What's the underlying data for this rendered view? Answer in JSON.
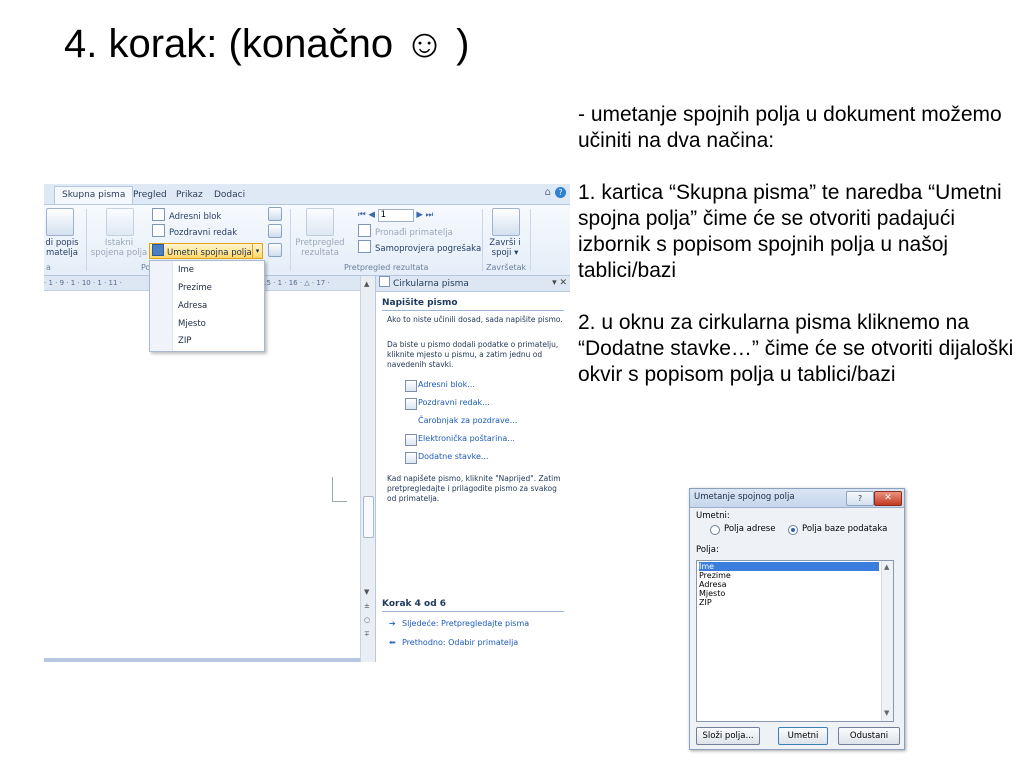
{
  "slide": {
    "title": "4. korak: (konačno ☺ )",
    "paragraphs": [
      "- umetanje spojnih polja u dokument možemo učiniti na dva načina:",
      "1. kartica “Skupna pisma” te naredba “Umetni spojna polja” čime će se otvoriti padajući izbornik s popisom spojnih polja u našoj tablici/bazi",
      "2. u oknu za cirkularna pisma kliknemo na “Dodatne stavke…” čime će se otvoriti dijaloški okvir s popisom polja u tablici/bazi"
    ]
  },
  "word": {
    "tabs": [
      "Skupna pisma",
      "Pregled",
      "Prikaz",
      "Dodaci"
    ],
    "tab_right": "⌂",
    "ribbon": {
      "di_popis_line1": "di popis",
      "di_popis_line2": "matelja",
      "istakni_line1": "Istakni",
      "istakni_line2": "spojena polja",
      "adresni_blok": "Adresni blok",
      "pozdravni_redak": "Pozdravni redak",
      "umetni_spojna_polja": "Umetni spojna polja",
      "pretpregled_line1": "Pretpregled",
      "pretpregled_line2": "rezultata",
      "record_number": "1",
      "pronadi": "Pronađi primatelja",
      "samoprovjera": "Samoprovjera pogrešaka",
      "zavrsi_line1": "Završi i",
      "zavrsi_line2": "spoji",
      "group_a": "a",
      "group_po": "Po",
      "group_pretpregled": "Pretpregled rezultata",
      "group_zavrsetak": "Završetak"
    },
    "dropdown": [
      "Ime",
      "Prezime",
      "Adresa",
      "Mjesto",
      "ZIP"
    ],
    "ruler": "· 1 · 9 · 1 · 10 · 1 · 11 ·",
    "ruler_right": "15 · 1 · 16 · △ · 17 ·",
    "pane": {
      "title": "Cirkularna pisma",
      "close": "▾ ✕",
      "heading": "Napišite pismo",
      "p1": "Ako to niste učinili dosad, sada napišite pismo.",
      "p2": "Da biste u pismo dodali podatke o primatelju, kliknite mjesto u pismu, a zatim jednu od navedenih stavki.",
      "links": [
        "Adresni blok...",
        "Pozdravni redak...",
        "Čarobnjak za pozdrave...",
        "Elektronička poštarina...",
        "Dodatne stavke..."
      ],
      "p3": "Kad napišete pismo, kliknite \"Naprijed\". Zatim pretpregledajte i prilagodite pismo za svakog od primatelja.",
      "step": "Korak 4 od 6",
      "next": "Sljedeće: Pretpregledajte pisma",
      "prev": "Prethodno: Odabir primatelja"
    }
  },
  "dialog": {
    "title": "Umetanje spojnog polja",
    "help": "?",
    "close": "✕",
    "umetni_label": "Umetni:",
    "radio1": "Polja adrese",
    "radio2": "Polja baze podataka",
    "polja_label": "Polja:",
    "fields": [
      "Ime",
      "Prezime",
      "Adresa",
      "Mjesto",
      "ZIP"
    ],
    "btn_slozi": "Složi polja...",
    "btn_umetni": "Umetni",
    "btn_odustani": "Odustani"
  }
}
